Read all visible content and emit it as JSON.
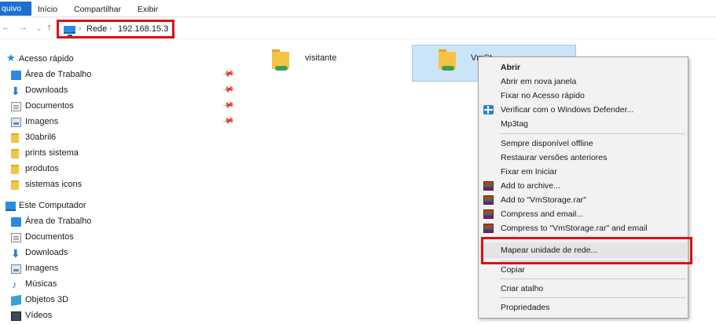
{
  "ribbon": {
    "file_tab": "quivo",
    "tabs": [
      "Início",
      "Compartilhar",
      "Exibir"
    ]
  },
  "address": {
    "crumbs": [
      "Rede",
      "192.168.15.3"
    ]
  },
  "nav": {
    "quick_access": "Acesso rápido",
    "quick_items": [
      {
        "label": "Área de Trabalho",
        "icon": "desktop-icon",
        "pinned": true
      },
      {
        "label": "Downloads",
        "icon": "download-icon",
        "pinned": true
      },
      {
        "label": "Documentos",
        "icon": "document-icon",
        "pinned": true
      },
      {
        "label": "Imagens",
        "icon": "pictures-icon",
        "pinned": true
      },
      {
        "label": "30abril6",
        "icon": "folder-icon",
        "pinned": false
      },
      {
        "label": "prints sistema",
        "icon": "folder-icon",
        "pinned": false
      },
      {
        "label": "produtos",
        "icon": "folder-icon",
        "pinned": false
      },
      {
        "label": "sistemas icons",
        "icon": "folder-icon",
        "pinned": false
      }
    ],
    "this_pc": "Este Computador",
    "pc_items": [
      {
        "label": "Área de Trabalho",
        "icon": "desktop-icon"
      },
      {
        "label": "Documentos",
        "icon": "document-icon"
      },
      {
        "label": "Downloads",
        "icon": "download-icon"
      },
      {
        "label": "Imagens",
        "icon": "pictures-icon"
      },
      {
        "label": "Músicas",
        "icon": "music-icon"
      },
      {
        "label": "Objetos 3D",
        "icon": "objects-3d-icon"
      },
      {
        "label": "Vídeos",
        "icon": "video-icon"
      }
    ]
  },
  "content": {
    "folders": [
      {
        "label": "visitante",
        "selected": false
      },
      {
        "label": "VmSt",
        "selected": true
      }
    ]
  },
  "context_menu": {
    "items": [
      {
        "label": "Abrir",
        "bold": true,
        "icon": ""
      },
      {
        "label": "Abrir em nova janela",
        "icon": ""
      },
      {
        "label": "Fixar no Acesso rápido",
        "icon": ""
      },
      {
        "label": "Verificar com o Windows Defender...",
        "icon": "windows-defender-icon"
      },
      {
        "label": "Mp3tag",
        "icon": ""
      },
      {
        "label": "Sempre disponível offline",
        "icon": ""
      },
      {
        "label": "Restaurar versões anteriores",
        "icon": ""
      },
      {
        "label": "Fixar em Iniciar",
        "icon": ""
      },
      {
        "label": "Add to archive...",
        "icon": "winrar-icon"
      },
      {
        "label": "Add to \"VmStorage.rar\"",
        "icon": "winrar-icon"
      },
      {
        "label": "Compress and email...",
        "icon": "winrar-icon"
      },
      {
        "label": "Compress to \"VmStorage.rar\" and email",
        "icon": "winrar-icon"
      },
      {
        "label": "Mapear unidade de rede...",
        "icon": "",
        "highlighted": true
      },
      {
        "label": "Copiar",
        "icon": ""
      },
      {
        "label": "Criar atalho",
        "icon": ""
      },
      {
        "label": "Propriedades",
        "icon": ""
      }
    ]
  },
  "colors": {
    "accent": "#1f6fcf",
    "highlight_box": "#e01010",
    "selection": "#cce4f7"
  }
}
